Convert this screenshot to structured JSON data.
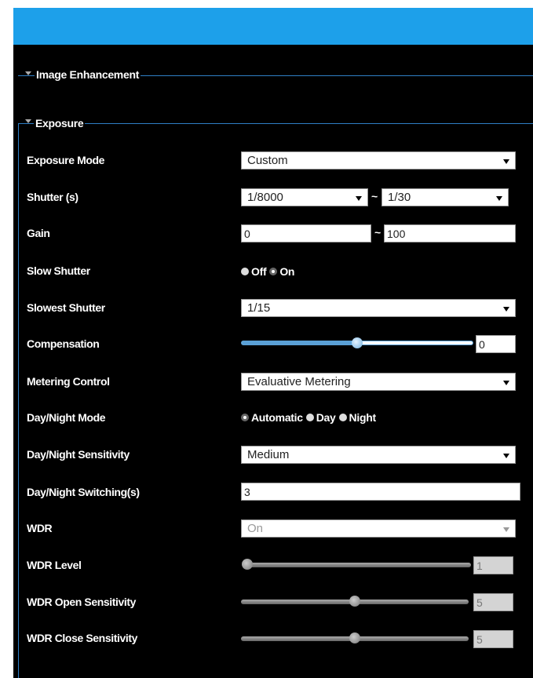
{
  "sections": {
    "image_enhancement": "Image Enhancement",
    "exposure": "Exposure"
  },
  "labels": {
    "exposure_mode": "Exposure Mode",
    "shutter": "Shutter (s)",
    "gain": "Gain",
    "slow_shutter": "Slow Shutter",
    "slowest_shutter": "Slowest Shutter",
    "compensation": "Compensation",
    "metering_control": "Metering Control",
    "day_night_mode": "Day/Night Mode",
    "day_night_sensitivity": "Day/Night Sensitivity",
    "day_night_switching": "Day/Night Switching(s)",
    "wdr": "WDR",
    "wdr_level": "WDR Level",
    "wdr_open_sensitivity": "WDR Open Sensitivity",
    "wdr_close_sensitivity": "WDR Close Sensitivity"
  },
  "values": {
    "exposure_mode": "Custom",
    "shutter_min": "1/8000",
    "shutter_max": "1/30",
    "gain_min": "0",
    "gain_max": "100",
    "slowest_shutter": "1/15",
    "compensation": "0",
    "metering_control": "Evaluative Metering",
    "day_night_sensitivity": "Medium",
    "day_night_switching": "3",
    "wdr": "On",
    "wdr_level": "1",
    "wdr_open_sensitivity": "5",
    "wdr_close_sensitivity": "5"
  },
  "separators": {
    "range": "~"
  },
  "radios": {
    "slow_shutter": [
      {
        "label": "Off",
        "checked": false
      },
      {
        "label": "On",
        "checked": true
      }
    ],
    "day_night_mode": [
      {
        "label": "Automatic",
        "checked": true
      },
      {
        "label": "Day",
        "checked": false
      },
      {
        "label": "Night",
        "checked": false
      }
    ]
  },
  "slider_levels": {
    "compensation": 0.5,
    "wdr_level": 0.0,
    "wdr_open_sensitivity": 0.5,
    "wdr_close_sensitivity": 0.5
  },
  "colors": {
    "header": "#1da0ea",
    "background": "#000000",
    "section_line": "#2f7fc6"
  },
  "icons": {
    "collapse": "triangle-down-icon",
    "dropdown": "chevron-down-icon"
  }
}
